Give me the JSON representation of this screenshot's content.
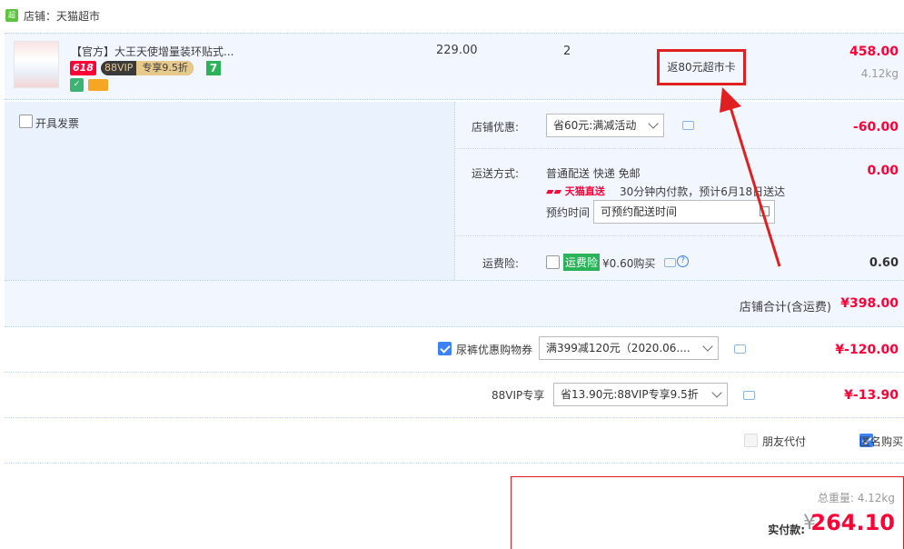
{
  "shop": {
    "logo_text": "超市",
    "name": "店铺：天猫超市"
  },
  "item": {
    "title": "【官方】大王天使增量装环贴式...",
    "tag_618": "618",
    "vip_label": "88VIP",
    "vip_discount": "专享9.5折",
    "seven_badge": "7",
    "unit_price": "229.00",
    "quantity": "2",
    "rebate_note": "返80元超市卡",
    "subtotal": "458.00",
    "weight": "4.12kg"
  },
  "invoice": {
    "label": "开具发票",
    "checked": false
  },
  "shop_discount": {
    "label": "店铺优惠:",
    "selected": "省60元:满减活动",
    "amount": "-60.00"
  },
  "delivery": {
    "label": "运送方式:",
    "method": "普通配送 快递 免邮",
    "tmall_badge": "天猫直送",
    "eta": "30分钟内付款，预计6月18日送达",
    "schedule_label": "预约时间",
    "schedule_value": "可预约配送时间",
    "amount": "0.00"
  },
  "insurance": {
    "label": "运费险:",
    "badge": "运费险",
    "price_text": "¥0.60购买",
    "amount": "0.60"
  },
  "shop_total": {
    "label": "店铺合计(含运费)",
    "amount": "¥398.00"
  },
  "coupon": {
    "label": "尿裤优惠购物券",
    "checked": true,
    "selected": "满399减120元（2020.06....",
    "amount": "¥-120.00"
  },
  "vip_exclusive": {
    "label": "88VIP专享",
    "selected": "省13.90元:88VIP专享9.5折",
    "amount": "¥-13.90"
  },
  "pay_options": {
    "friend_pay": "朋友代付",
    "friend_checked": false,
    "anonymous": "匿名购买",
    "anonymous_checked": true
  },
  "summary": {
    "weight_label": "总重量:",
    "weight_value": "4.12kg",
    "pay_label": "实付款:",
    "currency": "¥",
    "total": "264.10"
  },
  "colors": {
    "accent_red": "#ff0036",
    "annotation_red": "#e02020",
    "row_bg": "#f2f7ff",
    "checkbox_blue": "#3b82f6"
  }
}
